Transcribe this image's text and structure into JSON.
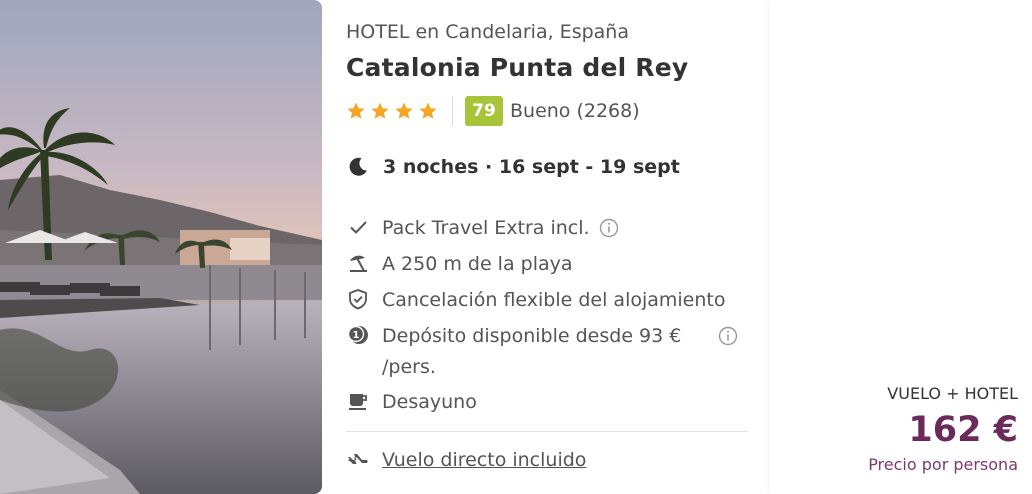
{
  "hotel": {
    "type_location": "HOTEL en Candelaria, España",
    "name": "Catalonia Punta del Rey",
    "stars": 4,
    "score": "79",
    "score_text": "Bueno (2268)",
    "colors": {
      "star": "#f5a623",
      "score_bg": "#a8c53a"
    }
  },
  "stay": {
    "dates_text": "3 noches · 16 sept - 19 sept",
    "icon": "moon-icon"
  },
  "features": [
    {
      "icon": "check-icon",
      "label": "Pack Travel Extra incl."
    },
    {
      "icon": "beach-umbrella-icon",
      "label": "A 250 m de la playa"
    },
    {
      "icon": "shield-check-icon",
      "label": "Cancelación flexible del alojamiento"
    },
    {
      "icon": "deposit-coin-icon",
      "label_line1": "Depósito disponible desde 93 €",
      "label_line2": "/pers."
    },
    {
      "icon": "coffee-cup-icon",
      "label": "Desayuno"
    }
  ],
  "flight": {
    "icon": "airplane-icon",
    "label": "Vuelo directo incluido"
  },
  "price": {
    "pack_type": "VUELO + HOTEL",
    "amount": "162 €",
    "per_person": "Precio por persona",
    "color": "#6b2a5a"
  }
}
